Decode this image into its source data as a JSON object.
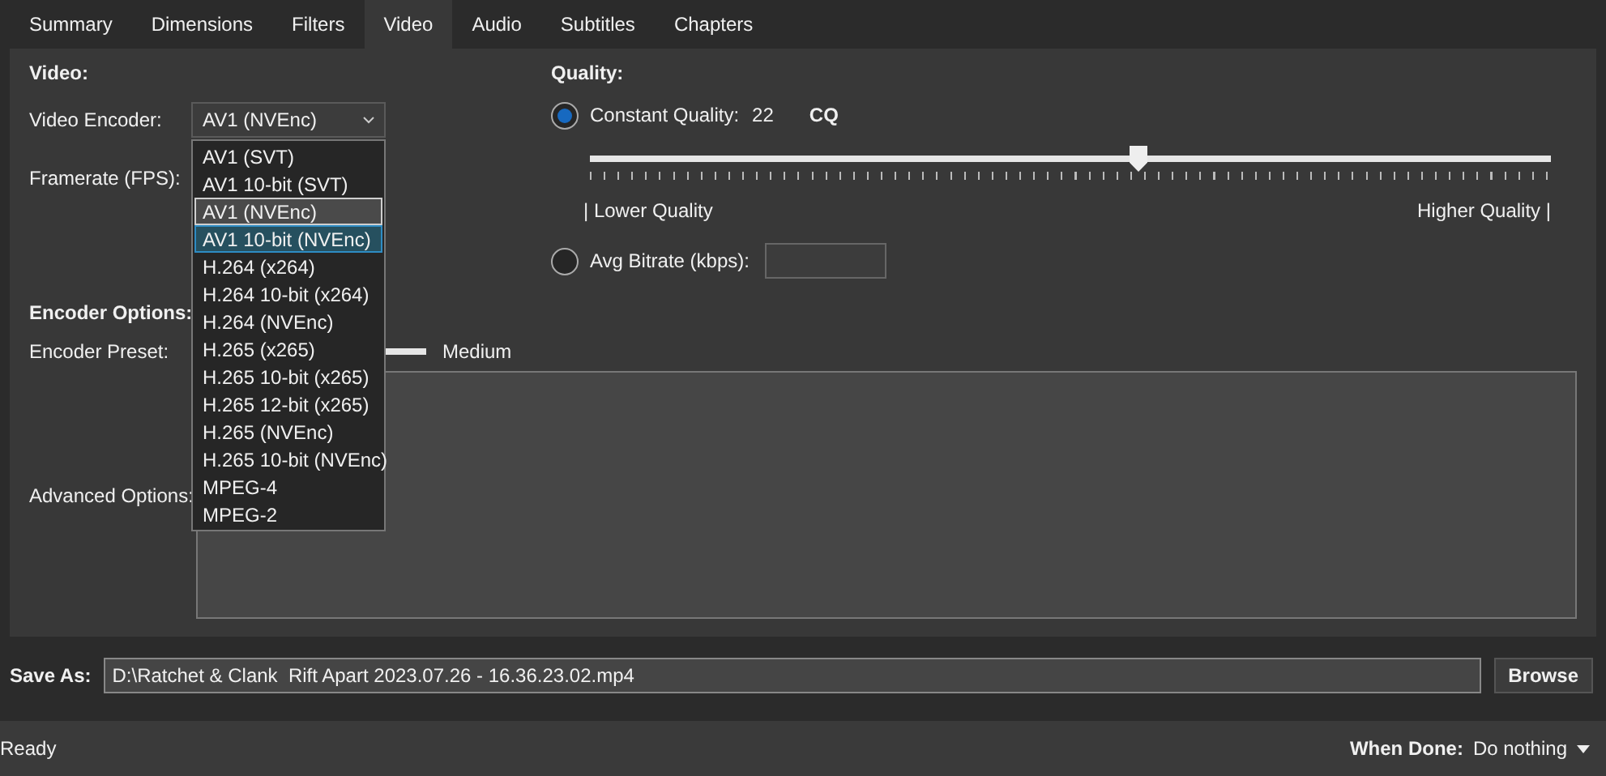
{
  "tabs": [
    {
      "label": "Summary",
      "selected": false
    },
    {
      "label": "Dimensions",
      "selected": false
    },
    {
      "label": "Filters",
      "selected": false
    },
    {
      "label": "Video",
      "selected": true
    },
    {
      "label": "Audio",
      "selected": false
    },
    {
      "label": "Subtitles",
      "selected": false
    },
    {
      "label": "Chapters",
      "selected": false
    }
  ],
  "video": {
    "heading": "Video:",
    "encoder_label": "Video Encoder:",
    "encoder_value": "AV1 (NVEnc)",
    "framerate_label": "Framerate (FPS):",
    "encoder_options": [
      {
        "label": "AV1 (SVT)",
        "selected": false,
        "hovered": false
      },
      {
        "label": "AV1 10-bit (SVT)",
        "selected": false,
        "hovered": false
      },
      {
        "label": "AV1 (NVEnc)",
        "selected": true,
        "hovered": false
      },
      {
        "label": "AV1 10-bit (NVEnc)",
        "selected": false,
        "hovered": true
      },
      {
        "label": "H.264 (x264)",
        "selected": false,
        "hovered": false
      },
      {
        "label": "H.264 10-bit (x264)",
        "selected": false,
        "hovered": false
      },
      {
        "label": "H.264 (NVEnc)",
        "selected": false,
        "hovered": false
      },
      {
        "label": "H.265 (x265)",
        "selected": false,
        "hovered": false
      },
      {
        "label": "H.265 10-bit (x265)",
        "selected": false,
        "hovered": false
      },
      {
        "label": "H.265 12-bit (x265)",
        "selected": false,
        "hovered": false
      },
      {
        "label": "H.265 (NVEnc)",
        "selected": false,
        "hovered": false
      },
      {
        "label": "H.265 10-bit (NVEnc)",
        "selected": false,
        "hovered": false
      },
      {
        "label": "MPEG-4",
        "selected": false,
        "hovered": false
      },
      {
        "label": "MPEG-2",
        "selected": false,
        "hovered": false
      }
    ]
  },
  "quality": {
    "heading": "Quality:",
    "constant_label": "Constant Quality:",
    "constant_selected": true,
    "constant_value": "22",
    "unit": "CQ",
    "level": 0.57,
    "low_label": "| Lower Quality",
    "high_label": "Higher Quality |",
    "bitrate_label": "Avg Bitrate (kbps):",
    "bitrate_selected": false
  },
  "encoder_options": {
    "heading": "Encoder Options:",
    "preset_label": "Encoder Preset:",
    "preset_value": "Medium",
    "advanced_label": "Advanced Options:"
  },
  "save": {
    "label": "Save As:",
    "value": "D:\\Ratchet & Clank  Rift Apart 2023.07.26 - 16.36.23.02.mp4",
    "button": "Browse"
  },
  "status_bar": {
    "status": "Ready",
    "when_done_label": "When Done:",
    "when_done_value": "Do nothing"
  }
}
